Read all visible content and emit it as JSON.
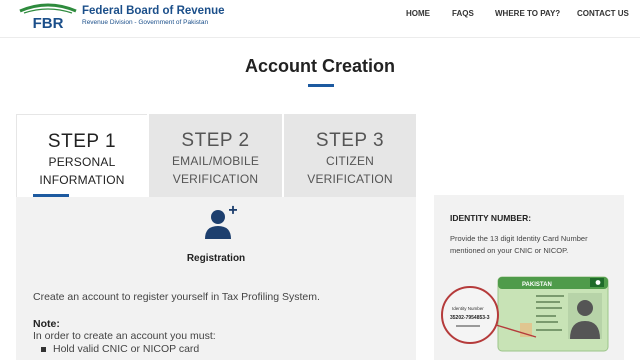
{
  "header": {
    "logo_text": "FBR",
    "brand_title": "Federal Board of Revenue",
    "brand_subtitle": "Revenue Division - Government of Pakistan",
    "nav": [
      "HOME",
      "FAQS",
      "WHERE TO PAY?",
      "CONTACT US"
    ]
  },
  "page": {
    "title": "Account Creation"
  },
  "steps": [
    {
      "num": "STEP 1",
      "line1": "PERSONAL",
      "line2": "INFORMATION",
      "active": true
    },
    {
      "num": "STEP 2",
      "line1": "EMAIL/MOBILE",
      "line2": "VERIFICATION",
      "active": false
    },
    {
      "num": "STEP 3",
      "line1": "CITIZEN",
      "line2": "VERIFICATION",
      "active": false
    }
  ],
  "panel": {
    "icon": "add-user-icon",
    "registration_label": "Registration",
    "intro": "Create an account to register yourself in Tax Profiling System.",
    "note_title": "Note:",
    "note_text": "In order to create an account you must:",
    "note_bullet": "Hold valid CNIC or NICOP card"
  },
  "sidebar": {
    "title": "IDENTITY NUMBER:",
    "text": "Provide the 13 digit Identity Card Number mentioned on your CNIC or NICOP.",
    "card": {
      "country": "PAKISTAN",
      "label": "Identity Number",
      "number": "35202-7954853-3"
    }
  },
  "colors": {
    "brand_blue": "#1b4f8a",
    "accent_blue": "#1d5aa0",
    "panel_gray": "#f2f2f2",
    "tab_gray": "#e6e6e6",
    "card_green": "#c8e3b6"
  }
}
